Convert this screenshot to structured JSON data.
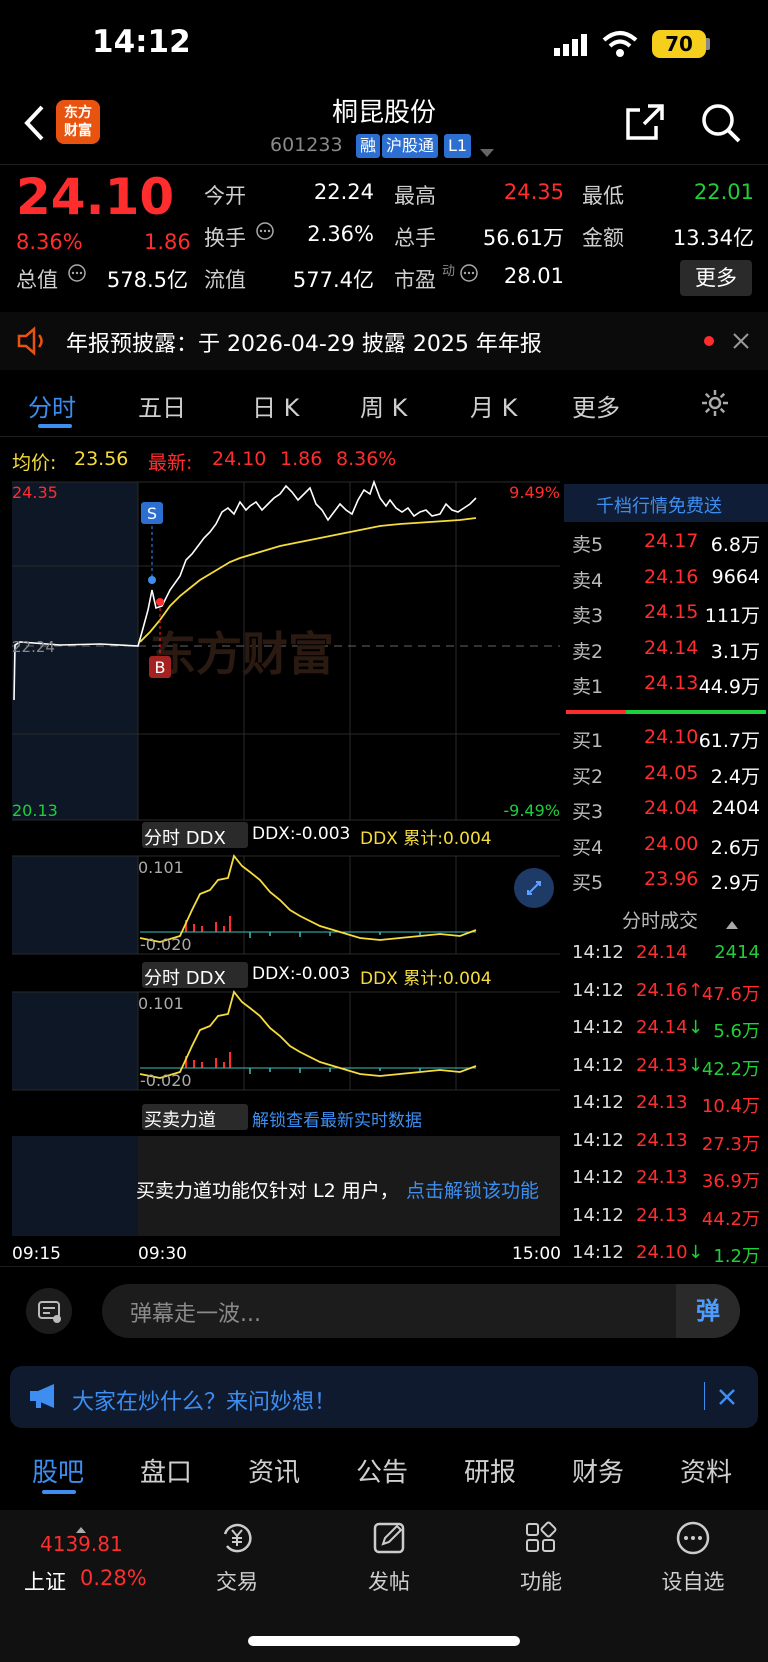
{
  "status": {
    "time": "14:12",
    "battery": "70"
  },
  "header": {
    "logo_line1": "东方",
    "logo_line2": "财富",
    "title": "桐昆股份",
    "code": "601233",
    "tags": [
      "融",
      "沪股通",
      "L1"
    ]
  },
  "quote": {
    "price": "24.10",
    "change_pct": "8.36%",
    "change": "1.86",
    "fields": {
      "open_label": "今开",
      "open": "22.24",
      "high_label": "最高",
      "high": "24.35",
      "low_label": "最低",
      "low": "22.01",
      "turnover_label": "换手",
      "turnover": "2.36%",
      "volume_label": "总手",
      "volume": "56.61万",
      "amount_label": "金额",
      "amount": "13.34亿",
      "total_cap_label": "总值",
      "total_cap": "578.5亿",
      "float_cap_label": "流值",
      "float_cap": "577.4亿",
      "pe_label": "市盈",
      "pe_sup": "动",
      "pe": "28.01"
    },
    "more_label": "更多"
  },
  "notice": {
    "text": "年报预披露：于 2026-04-29 披露 2025 年年报"
  },
  "tabs": [
    "分时",
    "五日",
    "日 K",
    "周 K",
    "月 K",
    "更多"
  ],
  "chart": {
    "avg_label": "均价:",
    "avg": "23.56",
    "latest_label": "最新:",
    "latest": "24.10",
    "latest_change": "1.86",
    "latest_pct": "8.36%",
    "y_high": "24.35",
    "y_low": "20.13",
    "y_mid": "22.24",
    "pct_high": "9.49%",
    "pct_low": "-9.49%",
    "watermark": "东方财富",
    "marker_s": "S",
    "marker_b": "B",
    "x_labels": [
      "09:15",
      "09:30",
      "15:00"
    ]
  },
  "ddx1": {
    "selector": "分时 DDX",
    "ddx": "DDX:-0.003",
    "ddx_sum": "DDX 累计:0.004",
    "top": "0.101",
    "bottom": "-0.020"
  },
  "ddx2": {
    "selector": "分时 DDX",
    "ddx": "DDX:-0.003",
    "ddx_sum": "DDX 累计:0.004",
    "top": "0.101",
    "bottom": "-0.020"
  },
  "force": {
    "selector": "买卖力道",
    "hint": "解锁查看最新实时数据",
    "lock_text": "买卖力道功能仅针对 L2 用户，",
    "lock_link": "点击解锁该功能"
  },
  "orderbook": {
    "banner": "千档行情免费送",
    "asks": [
      {
        "label": "卖5",
        "price": "24.17",
        "vol": "6.8万"
      },
      {
        "label": "卖4",
        "price": "24.16",
        "vol": "9664"
      },
      {
        "label": "卖3",
        "price": "24.15",
        "vol": "111万"
      },
      {
        "label": "卖2",
        "price": "24.14",
        "vol": "3.1万"
      },
      {
        "label": "卖1",
        "price": "24.13",
        "vol": "44.9万"
      }
    ],
    "bids": [
      {
        "label": "买1",
        "price": "24.10",
        "vol": "61.7万"
      },
      {
        "label": "买2",
        "price": "24.05",
        "vol": "2.4万"
      },
      {
        "label": "买3",
        "price": "24.04",
        "vol": "2404"
      },
      {
        "label": "买4",
        "price": "24.00",
        "vol": "2.6万"
      },
      {
        "label": "买5",
        "price": "23.96",
        "vol": "2.9万"
      }
    ],
    "trades_title": "分时成交",
    "trades": [
      {
        "time": "14:12",
        "price": "24.14",
        "arrow": "",
        "vol": "2414",
        "dir": "buy"
      },
      {
        "time": "14:12",
        "price": "24.16",
        "arrow": "↑",
        "vol": "47.6万",
        "dir": "sell"
      },
      {
        "time": "14:12",
        "price": "24.14",
        "arrow": "↓",
        "vol": "5.6万",
        "dir": "buy"
      },
      {
        "time": "14:12",
        "price": "24.13",
        "arrow": "↓",
        "vol": "42.2万",
        "dir": "buy"
      },
      {
        "time": "14:12",
        "price": "24.13",
        "arrow": "",
        "vol": "10.4万",
        "dir": "sell"
      },
      {
        "time": "14:12",
        "price": "24.13",
        "arrow": "",
        "vol": "27.3万",
        "dir": "sell"
      },
      {
        "time": "14:12",
        "price": "24.13",
        "arrow": "",
        "vol": "36.9万",
        "dir": "sell"
      },
      {
        "time": "14:12",
        "price": "24.13",
        "arrow": "",
        "vol": "44.2万",
        "dir": "sell"
      },
      {
        "time": "14:12",
        "price": "24.10",
        "arrow": "↓",
        "vol": "1.2万",
        "dir": "buy"
      }
    ]
  },
  "danmu": {
    "placeholder": "弹幕走一波...",
    "send": "弹"
  },
  "ask": {
    "text": "大家在炒什么？来问妙想！"
  },
  "bottom_tabs": [
    "股吧",
    "盘口",
    "资讯",
    "公告",
    "研报",
    "财务",
    "资料"
  ],
  "nav": {
    "index_value": "4139.81",
    "index_name": "上证",
    "index_pct": "0.28%",
    "items": [
      "交易",
      "发帖",
      "功能",
      "设自选"
    ]
  },
  "colors": {
    "up": "#ff2d2d",
    "down": "#1fcf3a",
    "accent": "#3d8ef0",
    "avg_line": "#f5dc3c"
  }
}
